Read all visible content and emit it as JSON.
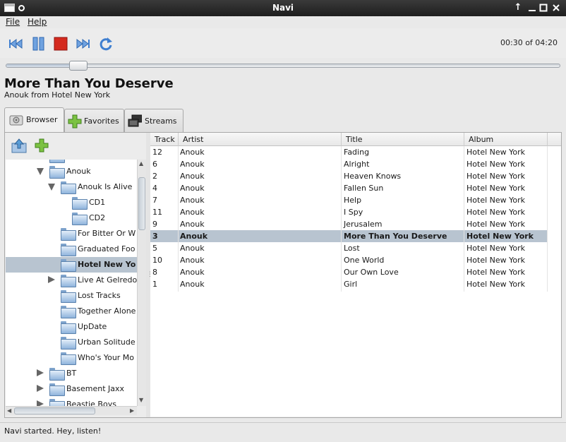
{
  "window": {
    "title": "Navi"
  },
  "menu": {
    "file": "File",
    "help": "Help"
  },
  "player": {
    "time": "00:30 of 04:20",
    "progress_fraction": 0.115
  },
  "now_playing": {
    "title": "More Than You Deserve",
    "subtitle": "Anouk from Hotel New York"
  },
  "tabs": [
    {
      "label": "Browser",
      "active": true
    },
    {
      "label": "Favorites",
      "active": false
    },
    {
      "label": "Streams",
      "active": false
    }
  ],
  "tree": [
    {
      "label": "Anouk",
      "depth": 1,
      "expander": "down"
    },
    {
      "label": "Anouk Is Alive",
      "depth": 2,
      "expander": "down"
    },
    {
      "label": "CD1",
      "depth": 3,
      "expander": "none"
    },
    {
      "label": "CD2",
      "depth": 3,
      "expander": "none"
    },
    {
      "label": "For Bitter Or W",
      "depth": 2,
      "expander": "none"
    },
    {
      "label": "Graduated Foo",
      "depth": 2,
      "expander": "none"
    },
    {
      "label": "Hotel New Yo",
      "depth": 2,
      "expander": "none",
      "selected": true
    },
    {
      "label": "Live At Gelredo",
      "depth": 2,
      "expander": "right"
    },
    {
      "label": "Lost Tracks",
      "depth": 2,
      "expander": "none"
    },
    {
      "label": "Together Alone",
      "depth": 2,
      "expander": "none"
    },
    {
      "label": "UpDate",
      "depth": 2,
      "expander": "none"
    },
    {
      "label": "Urban Solitude",
      "depth": 2,
      "expander": "none"
    },
    {
      "label": "Who's Your Mo",
      "depth": 2,
      "expander": "none"
    },
    {
      "label": "BT",
      "depth": 1,
      "expander": "right"
    },
    {
      "label": "Basement Jaxx",
      "depth": 1,
      "expander": "right"
    },
    {
      "label": "Beastie Boys",
      "depth": 1,
      "expander": "right"
    }
  ],
  "table": {
    "headers": {
      "track": "Track",
      "artist": "Artist",
      "title": "Title",
      "album": "Album"
    },
    "rows": [
      {
        "track": "12",
        "artist": "Anouk",
        "title": "Fading",
        "album": "Hotel New York"
      },
      {
        "track": "6",
        "artist": "Anouk",
        "title": "Alright",
        "album": "Hotel New York"
      },
      {
        "track": "2",
        "artist": "Anouk",
        "title": "Heaven Knows",
        "album": "Hotel New York"
      },
      {
        "track": "4",
        "artist": "Anouk",
        "title": "Fallen Sun",
        "album": "Hotel New York"
      },
      {
        "track": "7",
        "artist": "Anouk",
        "title": "Help",
        "album": "Hotel New York"
      },
      {
        "track": "11",
        "artist": "Anouk",
        "title": "I Spy",
        "album": "Hotel New York"
      },
      {
        "track": "9",
        "artist": "Anouk",
        "title": "Jerusalem",
        "album": "Hotel New York"
      },
      {
        "track": "3",
        "artist": "Anouk",
        "title": "More Than You Deserve",
        "album": "Hotel New York",
        "selected": true
      },
      {
        "track": "5",
        "artist": "Anouk",
        "title": "Lost",
        "album": "Hotel New York"
      },
      {
        "track": "10",
        "artist": "Anouk",
        "title": "One World",
        "album": "Hotel New York"
      },
      {
        "track": "8",
        "artist": "Anouk",
        "title": "Our Own Love",
        "album": "Hotel New York"
      },
      {
        "track": "1",
        "artist": "Anouk",
        "title": "Girl",
        "album": "Hotel New York"
      }
    ]
  },
  "status": {
    "text": "Navi started. Hey, listen!"
  },
  "icons": {
    "previous": "skip-back-icon",
    "pause": "pause-icon",
    "stop": "stop-icon",
    "next": "skip-forward-icon",
    "repeat": "repeat-icon",
    "up": "folder-up-icon",
    "add": "add-icon"
  },
  "colors": {
    "selection": "#b8c4d0",
    "stop_red": "#d42a1e",
    "accent_blue": "#3f7fd0"
  }
}
